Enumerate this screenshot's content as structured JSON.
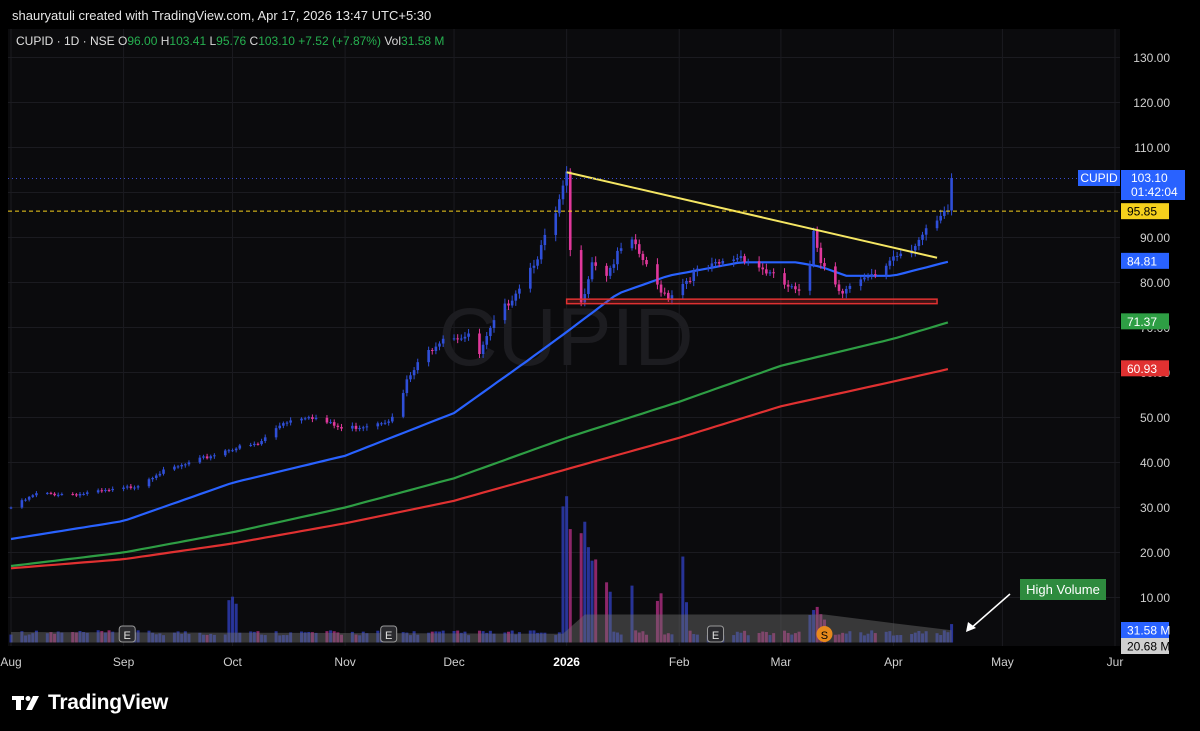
{
  "header": {
    "created_by": "shauryatuli created with TradingView.com, Apr 17, 2026 13:47 UTC+5:30"
  },
  "legend": {
    "symbol": "CUPID · 1D · NSE",
    "open_label": "O",
    "open": "96.00",
    "high_label": "H",
    "high": "103.41",
    "low_label": "L",
    "low": "95.76",
    "close_label": "C",
    "close": "103.10",
    "change": "+7.52 (+7.87%)",
    "vol_label": "Vol",
    "vol": "31.58 M"
  },
  "watermark": "CUPID",
  "branding": {
    "logo_text": "TradingView"
  },
  "annotation": {
    "label": "High Volume",
    "color": "#2e8b3e"
  },
  "price_tags": [
    {
      "id": "last",
      "label": "CUPID",
      "value": "103.10",
      "sub": "01:42:04",
      "color": "#2962ff"
    },
    {
      "id": "hline",
      "value": "95.85",
      "color": "#f5d01c"
    },
    {
      "id": "ema_fast",
      "value": "84.81",
      "color": "#2962ff"
    },
    {
      "id": "ema_mid",
      "value": "71.37",
      "color": "#2e9e44"
    },
    {
      "id": "ema_slow",
      "value": "60.93",
      "color": "#e03131"
    },
    {
      "id": "vol",
      "value": "31.58 M",
      "color": "#2962ff"
    },
    {
      "id": "vol_ma",
      "value": "20.68 M",
      "color": "#d0d0d0"
    }
  ],
  "event_markers": [
    {
      "kind": "E",
      "date": "2025-09-02"
    },
    {
      "kind": "E",
      "date": "2025-11-13"
    },
    {
      "kind": "E",
      "date": "2026-02-11"
    },
    {
      "kind": "S",
      "date": "2026-03-13"
    }
  ],
  "chart_data": {
    "type": "candlestick",
    "symbol": "CUPID",
    "interval": "1D",
    "exchange": "NSE",
    "x_range": [
      "2025-08-01",
      "2026-06-01"
    ],
    "ylim": [
      0,
      135
    ],
    "y_ticks": [
      10,
      20,
      30,
      40,
      50,
      60,
      70,
      80,
      90,
      100,
      110,
      120,
      130
    ],
    "x_ticks": [
      {
        "date": "2025-08-01",
        "label": "Aug"
      },
      {
        "date": "2025-09-01",
        "label": "Sep"
      },
      {
        "date": "2025-10-01",
        "label": "Oct"
      },
      {
        "date": "2025-11-01",
        "label": "Nov"
      },
      {
        "date": "2025-12-01",
        "label": "Dec"
      },
      {
        "date": "2026-01-01",
        "label": "2026"
      },
      {
        "date": "2026-02-01",
        "label": "Feb"
      },
      {
        "date": "2026-03-01",
        "label": "Mar"
      },
      {
        "date": "2026-04-01",
        "label": "Apr"
      },
      {
        "date": "2026-05-01",
        "label": "May"
      },
      {
        "date": "2026-06-01",
        "label": "Jur"
      }
    ],
    "colors": {
      "up": "#2f4fd8",
      "down": "#e0389b",
      "ema_fast": "#2962ff",
      "ema_mid": "#2e9e44",
      "ema_slow": "#e03131",
      "trendline": "#f5e663",
      "support": "#e03131",
      "volume_ma_area": "#6e6e6e"
    },
    "price_path": [
      [
        "2025-08-01",
        30
      ],
      [
        "2025-08-08",
        33
      ],
      [
        "2025-08-20",
        33
      ],
      [
        "2025-08-31",
        34
      ],
      [
        "2025-09-05",
        35
      ],
      [
        "2025-09-10",
        37.5
      ],
      [
        "2025-09-20",
        40
      ],
      [
        "2025-09-30",
        43
      ],
      [
        "2025-10-08",
        44
      ],
      [
        "2025-10-15",
        49
      ],
      [
        "2025-10-22",
        50.5
      ],
      [
        "2025-10-31",
        47.5
      ],
      [
        "2025-11-05",
        48
      ],
      [
        "2025-11-15",
        50
      ],
      [
        "2025-11-18",
        58
      ],
      [
        "2025-11-22",
        63
      ],
      [
        "2025-11-28",
        68
      ],
      [
        "2025-12-05",
        68
      ],
      [
        "2025-12-08",
        64
      ],
      [
        "2025-12-12",
        71
      ],
      [
        "2025-12-18",
        78
      ],
      [
        "2025-12-24",
        86
      ],
      [
        "2025-12-29",
        95
      ],
      [
        "2026-01-01",
        103.5
      ],
      [
        "2026-01-02",
        87
      ],
      [
        "2026-01-05",
        75
      ],
      [
        "2026-01-08",
        85
      ],
      [
        "2026-01-12",
        82
      ],
      [
        "2026-01-18",
        90
      ],
      [
        "2026-01-22",
        85
      ],
      [
        "2026-01-25",
        80
      ],
      [
        "2026-01-29",
        77
      ],
      [
        "2026-02-05",
        82
      ],
      [
        "2026-02-12",
        84
      ],
      [
        "2026-02-18",
        86
      ],
      [
        "2026-02-24",
        83
      ],
      [
        "2026-03-01",
        80
      ],
      [
        "2026-03-05",
        78
      ],
      [
        "2026-03-08",
        76
      ],
      [
        "2026-03-10",
        92
      ],
      [
        "2026-03-12",
        85
      ],
      [
        "2026-03-15",
        81
      ],
      [
        "2026-03-18",
        78
      ],
      [
        "2026-03-23",
        80
      ],
      [
        "2026-03-28",
        82
      ],
      [
        "2026-04-01",
        86
      ],
      [
        "2026-04-06",
        88
      ],
      [
        "2026-04-10",
        91
      ],
      [
        "2026-04-14",
        94
      ],
      [
        "2026-04-16",
        96
      ],
      [
        "2026-04-17",
        103.1
      ]
    ],
    "ema_fast": [
      [
        "2025-08-01",
        23
      ],
      [
        "2025-09-01",
        27
      ],
      [
        "2025-10-01",
        35.5
      ],
      [
        "2025-11-01",
        41.5
      ],
      [
        "2025-12-01",
        51
      ],
      [
        "2025-12-21",
        62.5
      ],
      [
        "2026-01-01",
        69
      ],
      [
        "2026-01-15",
        77.5
      ],
      [
        "2026-01-29",
        81.5
      ],
      [
        "2026-02-18",
        84.5
      ],
      [
        "2026-03-05",
        84.5
      ],
      [
        "2026-03-12",
        83.5
      ],
      [
        "2026-03-19",
        81.5
      ],
      [
        "2026-04-01",
        81.5
      ],
      [
        "2026-04-17",
        84.81
      ]
    ],
    "ema_mid": [
      [
        "2025-08-01",
        17
      ],
      [
        "2025-09-01",
        20
      ],
      [
        "2025-10-01",
        24.5
      ],
      [
        "2025-11-01",
        30
      ],
      [
        "2025-12-01",
        36.5
      ],
      [
        "2026-01-01",
        45.5
      ],
      [
        "2026-02-01",
        53.5
      ],
      [
        "2026-03-01",
        61.5
      ],
      [
        "2026-04-01",
        67.5
      ],
      [
        "2026-04-17",
        71.37
      ]
    ],
    "ema_slow": [
      [
        "2025-08-01",
        16.5
      ],
      [
        "2025-09-01",
        18.5
      ],
      [
        "2025-10-01",
        22
      ],
      [
        "2025-11-01",
        26.5
      ],
      [
        "2025-12-01",
        31.5
      ],
      [
        "2026-01-01",
        38.5
      ],
      [
        "2026-02-01",
        45.5
      ],
      [
        "2026-03-01",
        52.5
      ],
      [
        "2026-04-01",
        58
      ],
      [
        "2026-04-17",
        60.93
      ]
    ],
    "trendline": {
      "from": [
        "2026-01-01",
        104.5
      ],
      "to": [
        "2026-04-13",
        85.5
      ]
    },
    "horizontal_line": {
      "value": 95.85,
      "from": "2026-01-01"
    },
    "support_box": {
      "from": "2026-01-01",
      "to": "2026-04-13",
      "low": 75.3,
      "high": 76.3
    },
    "volume": {
      "unit": "M",
      "last": 31.58,
      "ma": 20.68,
      "spikes": [
        [
          "2025-10-01",
          28
        ],
        [
          "2026-01-01",
          85
        ],
        [
          "2026-01-05",
          70
        ],
        [
          "2026-01-08",
          55
        ],
        [
          "2026-01-12",
          40
        ],
        [
          "2026-01-18",
          35
        ],
        [
          "2026-01-26",
          30
        ],
        [
          "2026-02-01",
          65
        ],
        [
          "2026-02-02",
          30
        ],
        [
          "2026-03-10",
          22
        ],
        [
          "2026-03-13",
          18
        ]
      ],
      "ma_path": [
        [
          "2025-08-01",
          6
        ],
        [
          "2025-12-31",
          5
        ],
        [
          "2026-01-06",
          16
        ],
        [
          "2026-02-10",
          16
        ],
        [
          "2026-03-13",
          16
        ],
        [
          "2026-04-01",
          11
        ],
        [
          "2026-04-17",
          7
        ]
      ]
    }
  }
}
